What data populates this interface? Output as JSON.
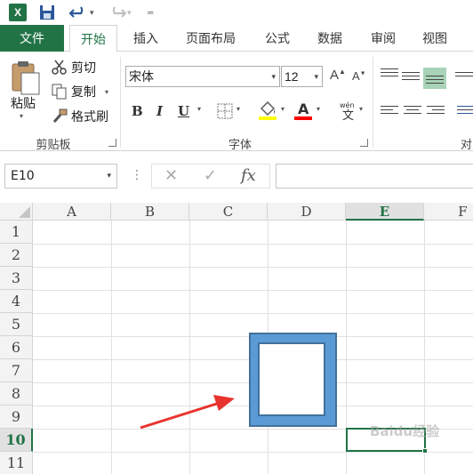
{
  "titlebar": {
    "app_icon_label": "X",
    "icons": [
      "excel-icon",
      "save-icon",
      "undo-icon",
      "redo-icon",
      "customize-qat-icon"
    ]
  },
  "tabs": [
    {
      "label": "文件"
    },
    {
      "label": "开始"
    },
    {
      "label": "插入"
    },
    {
      "label": "页面布局"
    },
    {
      "label": "公式"
    },
    {
      "label": "数据"
    },
    {
      "label": "审阅"
    },
    {
      "label": "视图"
    }
  ],
  "ribbon": {
    "clipboard": {
      "paste_label": "粘贴",
      "cut_label": "剪切",
      "copy_label": "复制",
      "format_painter_label": "格式刷",
      "group_label": "剪贴板"
    },
    "font": {
      "font_name": "宋体",
      "font_size": "12",
      "bold_label": "B",
      "italic_label": "I",
      "underline_label": "U",
      "grow_label": "A",
      "shrink_label": "A",
      "font_color_label": "A",
      "phonetic_label": "wén",
      "group_label": "字体",
      "fill_color": "#ffff00",
      "font_color": "#ff0000"
    },
    "alignment": {
      "group_label_partial": "对"
    }
  },
  "formula_bar": {
    "name_box": "E10",
    "cancel_label": "✕",
    "enter_label": "✓",
    "fx_label": "fx",
    "formula_value": ""
  },
  "sheet": {
    "columns": [
      "A",
      "B",
      "C",
      "D",
      "E",
      "F"
    ],
    "rows": [
      "1",
      "2",
      "3",
      "4",
      "5",
      "6",
      "7",
      "8",
      "9",
      "10",
      "11"
    ],
    "selected_column": "E",
    "selected_row": "10",
    "shape_fill": "#5b9bd5",
    "arrow_color": "#e8322d",
    "watermark": "Baidu经验"
  }
}
